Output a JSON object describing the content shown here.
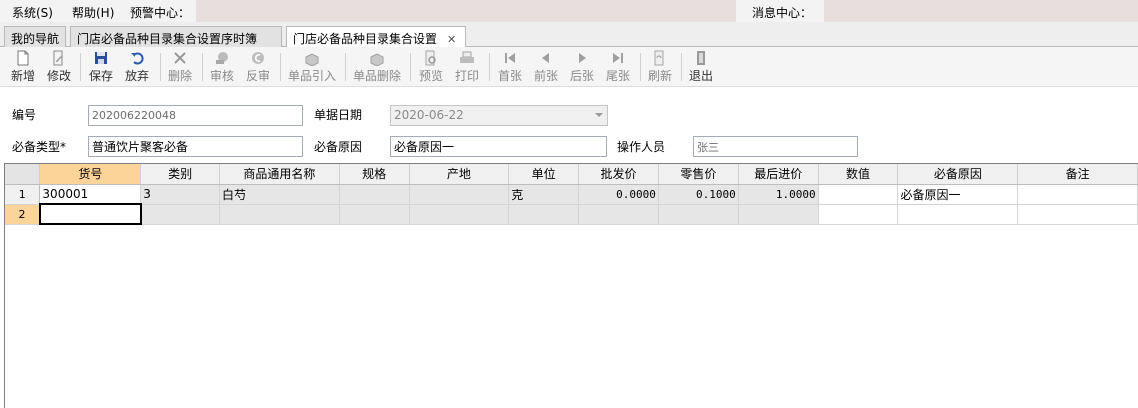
{
  "menubar": {
    "system": "系统(S)",
    "help": "帮助(H)",
    "alert_center": "预警中心：",
    "message_center": "消息中心："
  },
  "tabs": [
    {
      "label": "我的导航"
    },
    {
      "label": "门店必备品种目录集合设置序时簿"
    },
    {
      "label": "门店必备品种目录集合设置",
      "close": "✕"
    }
  ],
  "toolbar": {
    "new": "新增",
    "edit": "修改",
    "save": "保存",
    "discard": "放弃",
    "delete": "删除",
    "audit": "审核",
    "unaudit": "反审",
    "import_item": "单品引入",
    "delete_item": "单品删除",
    "preview": "预览",
    "print": "打印",
    "first": "首张",
    "prev": "前张",
    "next": "后张",
    "last": "尾张",
    "refresh": "刷新",
    "exit": "退出"
  },
  "form": {
    "code_label": "编号",
    "code_value": "202006220048",
    "date_label": "单据日期",
    "date_value": "2020-06-22",
    "type_label": "必备类型*",
    "type_value": "普通饮片聚客必备",
    "reason_label": "必备原因",
    "reason_value": "必备原因一",
    "operator_label": "操作人员",
    "operator_value": "张三"
  },
  "grid": {
    "columns": [
      "货号",
      "类别",
      "商品通用名称",
      "规格",
      "产地",
      "单位",
      "批发价",
      "零售价",
      "最后进价",
      "数值",
      "必备原因",
      "备注"
    ],
    "rows": [
      {
        "no": "1",
        "cells": [
          "300001",
          "3",
          "白芍",
          "",
          "",
          "克",
          "0.0000",
          "0.1000",
          "1.0000",
          "",
          "必备原因一",
          ""
        ]
      },
      {
        "no": "2",
        "cells": [
          "",
          "",
          "",
          "",
          "",
          "",
          "",
          "",
          "",
          "",
          "",
          ""
        ]
      }
    ]
  }
}
